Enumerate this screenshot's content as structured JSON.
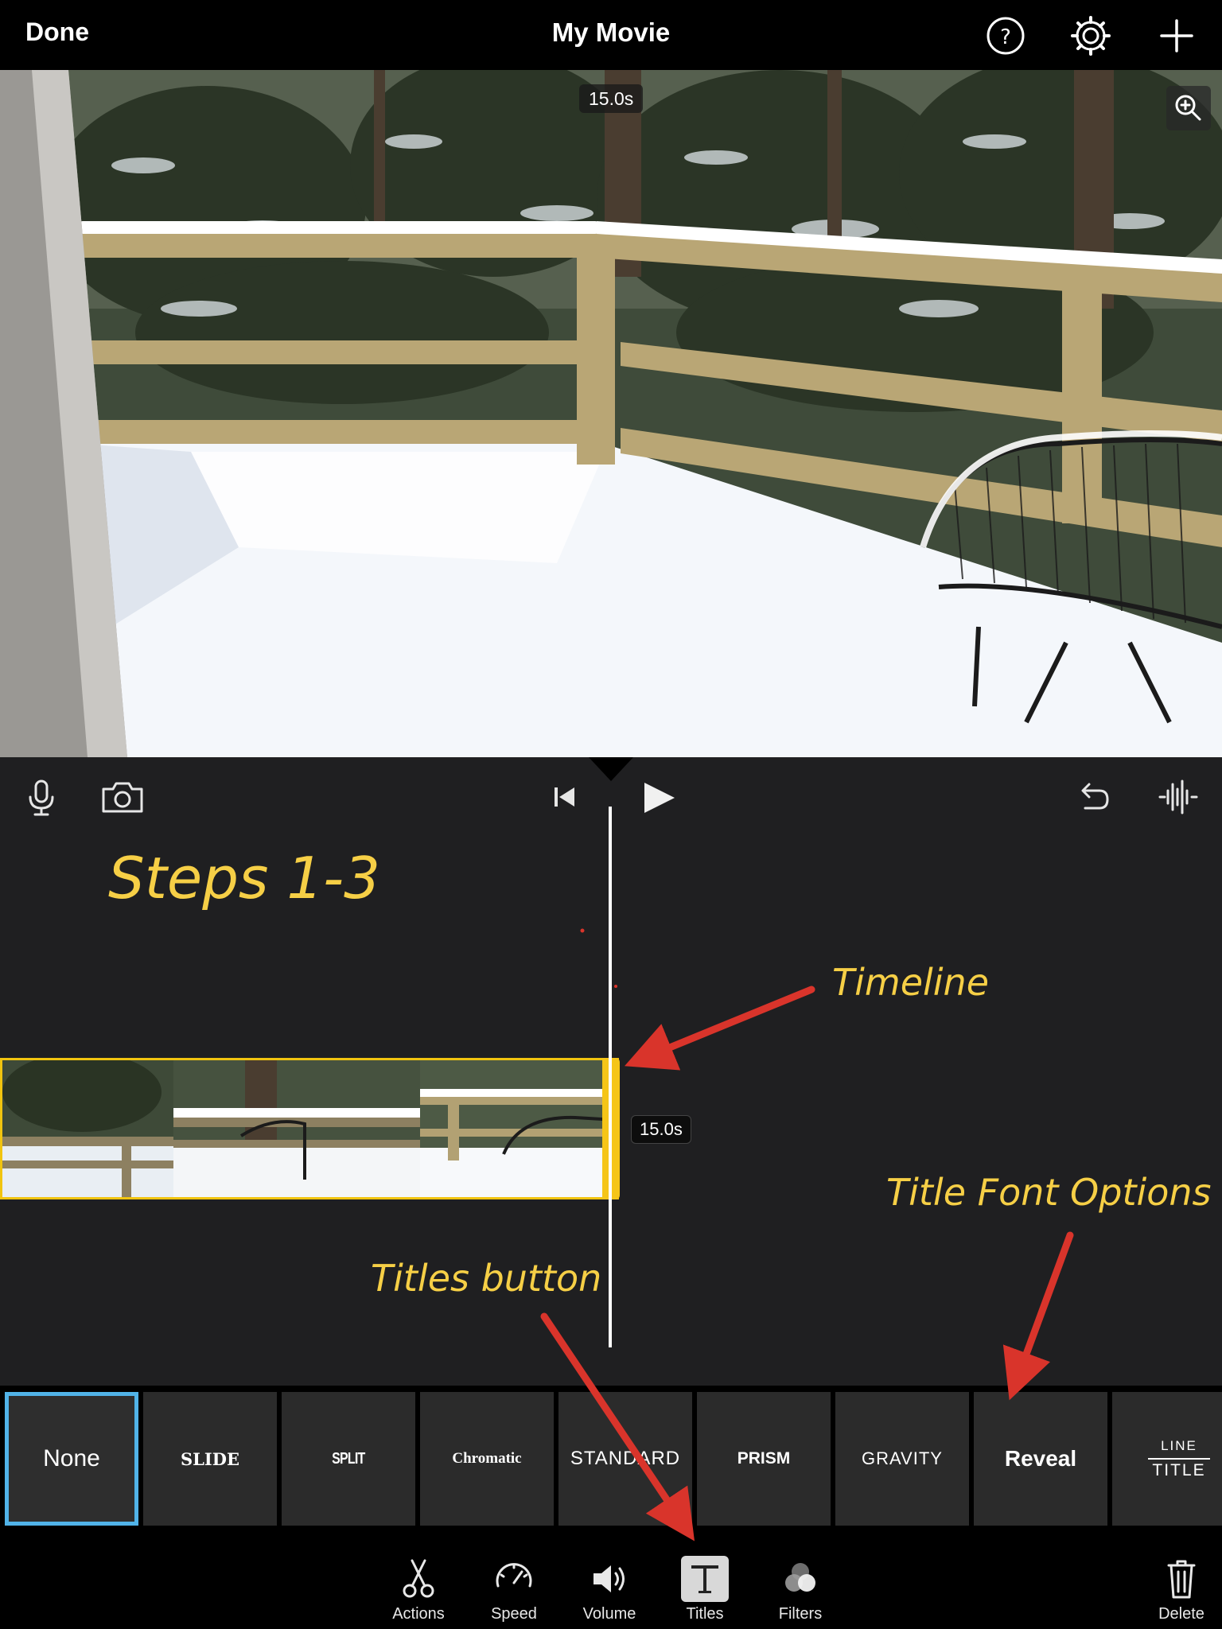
{
  "topbar": {
    "done_label": "Done",
    "title": "My Movie",
    "icons": [
      "help-icon",
      "settings-gear-icon",
      "add-plus-icon"
    ]
  },
  "viewer": {
    "duration": "15.0s",
    "zoom_icon": "zoom-in-icon"
  },
  "timeline": {
    "toolbar_icons": [
      "microphone-icon",
      "camera-icon",
      "skip-to-start-icon",
      "play-icon",
      "undo-icon",
      "audio-waveform-icon"
    ],
    "clip_duration": "15.0s"
  },
  "annotations": {
    "heading": "Steps 1-3",
    "timeline_label": "Timeline",
    "titles_button_label": "Titles button",
    "font_options_label": "Title Font Options",
    "color": "#f6cf46",
    "arrow_color": "#d9342b"
  },
  "title_styles": [
    {
      "label": "None",
      "selected": true
    },
    {
      "label": "SLIDE"
    },
    {
      "label": "SPLIT"
    },
    {
      "label": "Chromatic"
    },
    {
      "label": "STANDARD"
    },
    {
      "label": "PRISM"
    },
    {
      "label": "GRAVITY"
    },
    {
      "label": "Reveal"
    },
    {
      "label_top": "LINE",
      "label_bottom": "TITLE"
    }
  ],
  "bottom_toolbar": {
    "actions": "Actions",
    "speed": "Speed",
    "volume": "Volume",
    "titles": "Titles",
    "filters": "Filters",
    "delete": "Delete",
    "active": "Titles"
  },
  "colors": {
    "accent_yellow": "#f1c40f",
    "selected_blue": "#51b3e8",
    "panel_bg": "#1f1f21"
  }
}
